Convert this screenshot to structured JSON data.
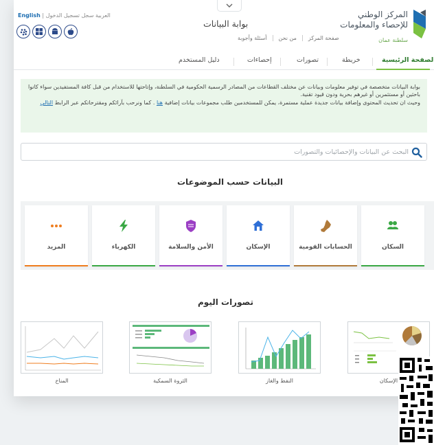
{
  "header": {
    "logo_line1": "المركز الوطني",
    "logo_line2": "للإحصاء والمعلومات",
    "logo_line3": "سلطنة عمان",
    "site_title": "بوابة البيانات",
    "top_links": [
      "صفحة المركز",
      "من نحن",
      "أسئلة وأجوبة"
    ],
    "lang": {
      "english": "English",
      "arabic": "العربية",
      "signup": "سجل",
      "login": "تسجيل الدخول"
    },
    "apps": [
      "blackberry-icon",
      "windows-icon",
      "android-icon",
      "apple-icon"
    ]
  },
  "nav": {
    "items": [
      "الصفحة الرئيسية",
      "خريطة",
      "تصورات",
      "إحصاءات",
      "دليل المستخدم"
    ],
    "active": "الصفحة الرئيسية"
  },
  "intro": {
    "p1": "بوابة البيانات متخصصة في توفير معلومات وبيانات عن مختلف القطاعات من المصادر الرسمية الحكومية في السلطنة، وإتاحتها للاستخدام من قبل كافة المستفيدين سواء كانوا باحثين أو مستثمرين أو غيرهم بحرية ودون قيود تقنية.",
    "p2_before": "وحيث ان تحديث المحتوى وإضافة بيانات جديدة عملية مستمرة، يمكن للمستخدمين طلب مجموعات بيانات إضافية",
    "p2_link1": "هنا",
    "p2_middle": ". كما ونرحب بآرائكم ومقترحاتكم عبر الرابط",
    "p2_link2": "التالي"
  },
  "search": {
    "placeholder": "البحث عن البيانات والإحصائيات والتصورات"
  },
  "topics_title": "البيانات حسب الموضوعات",
  "topics": [
    {
      "label": "السكان",
      "icon": "people-icon",
      "color": "#3aa845"
    },
    {
      "label": "الحسابات القومية",
      "icon": "oman-map-icon",
      "color": "#b07a3a"
    },
    {
      "label": "الإسكان",
      "icon": "house-icon",
      "color": "#2f6fd6"
    },
    {
      "label": "الأمن والسلامة",
      "icon": "shield-icon",
      "color": "#9b3fc4"
    },
    {
      "label": "الكهرباء",
      "icon": "lightning-icon",
      "color": "#3aa845"
    },
    {
      "label": "المزيد",
      "icon": "more-icon",
      "color": "#ef7d1f"
    }
  ],
  "viz_title": "تصورات اليوم",
  "visualizations": [
    {
      "label": "الإسكان"
    },
    {
      "label": "النفط والغاز"
    },
    {
      "label": "الثروة السمكية"
    },
    {
      "label": "المناخ"
    }
  ]
}
